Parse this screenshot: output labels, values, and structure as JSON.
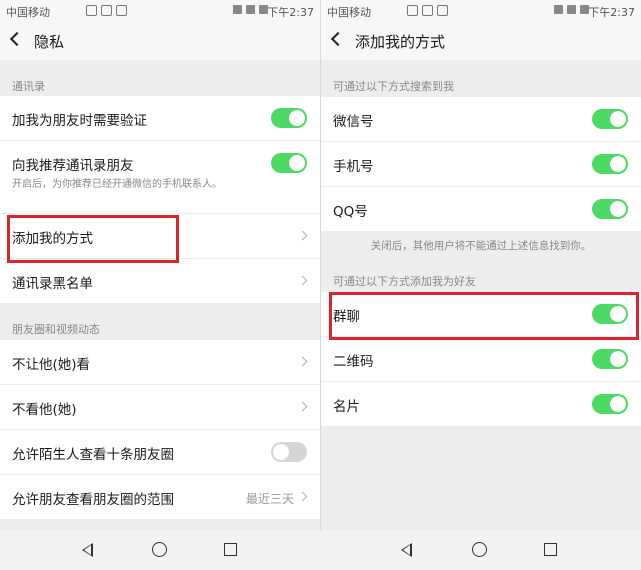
{
  "left": {
    "status": {
      "carrier": "中国移动",
      "time": "下午2:37"
    },
    "title": "隐私",
    "sections": [
      {
        "label": "通讯录"
      },
      {
        "label": "朋友圈和视频动态"
      }
    ],
    "rows": [
      {
        "label": "加我为朋友时需要验证",
        "toggle": "on"
      },
      {
        "label": "向我推荐通讯录朋友",
        "toggle": "on",
        "sub": "开启后，为你推荐已经开通微信的手机联系人。"
      },
      {
        "label": "添加我的方式"
      },
      {
        "label": "通讯录黑名单"
      },
      {
        "label": "不让他(她)看"
      },
      {
        "label": "不看他(她)"
      },
      {
        "label": "允许陌生人查看十条朋友圈",
        "toggle": "off"
      },
      {
        "label": "允许朋友查看朋友圈的范围",
        "value": "最近三天"
      }
    ]
  },
  "right": {
    "status": {
      "carrier": "中国移动",
      "time": "下午2:37"
    },
    "title": "添加我的方式",
    "sections": [
      {
        "label": "可通过以下方式搜索到我"
      },
      {
        "label": "可通过以下方式添加我为好友"
      }
    ],
    "rows": [
      {
        "label": "微信号",
        "toggle": "on"
      },
      {
        "label": "手机号",
        "toggle": "on"
      },
      {
        "label": "QQ号",
        "toggle": "on"
      },
      {
        "label": "群聊",
        "toggle": "on"
      },
      {
        "label": "二维码",
        "toggle": "on"
      },
      {
        "label": "名片",
        "toggle": "on"
      }
    ],
    "note": "关闭后，其他用户将不能通过上述信息找到你。"
  },
  "colors": {
    "toggle_on": "#4cd964",
    "highlight": "#d9262e"
  },
  "navbar_icons": [
    "back-triangle-icon",
    "home-circle-icon",
    "recent-square-icon"
  ]
}
